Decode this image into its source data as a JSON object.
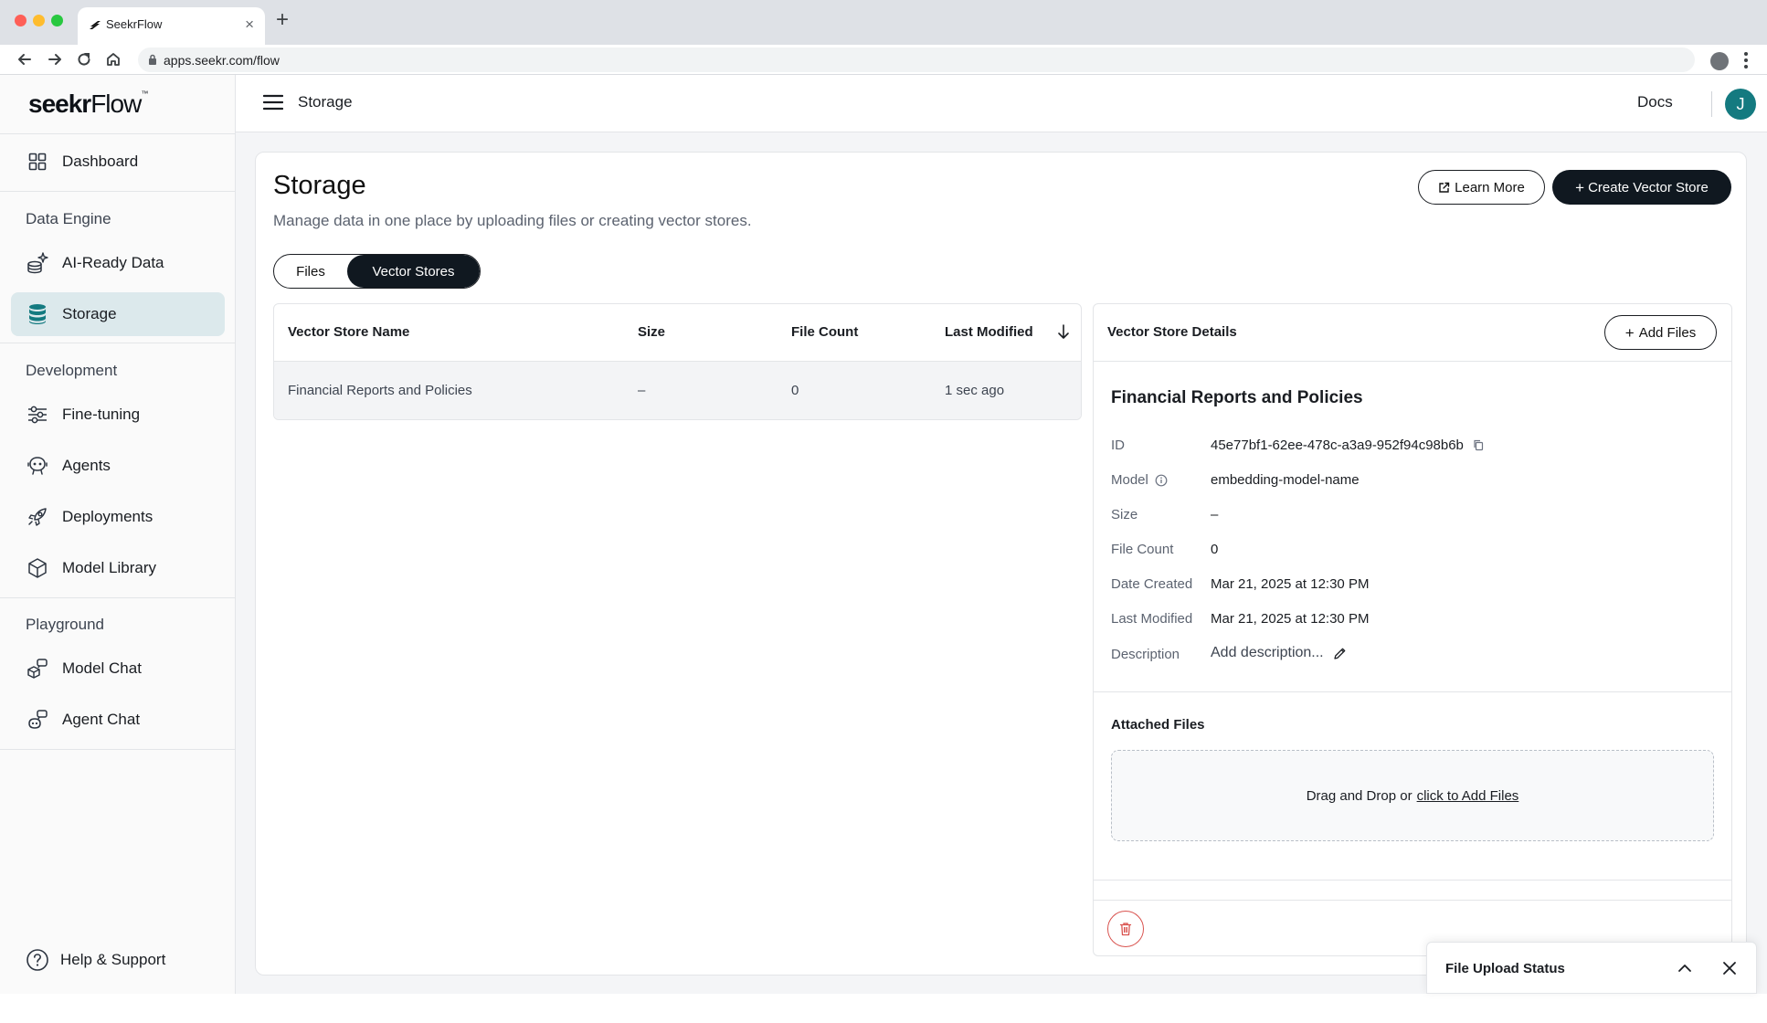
{
  "browser": {
    "tab_title": "SeekrFlow",
    "url": "apps.seekr.com/flow"
  },
  "sidebar": {
    "logo_main": "seekr",
    "logo_flow": "Flow",
    "logo_tm": "™",
    "dashboard": "Dashboard",
    "sections": {
      "data_engine": "Data Engine",
      "development": "Development",
      "playground": "Playground"
    },
    "items": {
      "ai_ready_data": "AI-Ready Data",
      "storage": "Storage",
      "fine_tuning": "Fine-tuning",
      "agents": "Agents",
      "deployments": "Deployments",
      "model_library": "Model Library",
      "model_chat": "Model Chat",
      "agent_chat": "Agent Chat"
    },
    "help": "Help & Support"
  },
  "topbar": {
    "breadcrumb": "Storage",
    "docs": "Docs",
    "avatar_initial": "J"
  },
  "page": {
    "title": "Storage",
    "subtitle": "Manage data in one place by uploading files or creating vector stores.",
    "learn_more": "Learn More",
    "create_vector_store": "Create Vector Store",
    "tabs": [
      "Files",
      "Vector Stores"
    ],
    "active_tab": "Vector Stores"
  },
  "table": {
    "columns": [
      "Vector Store Name",
      "Size",
      "File Count",
      "Last Modified"
    ],
    "sort_column": "Last Modified",
    "sort_direction": "desc",
    "rows": [
      {
        "name": "Financial Reports and Policies",
        "size": "–",
        "file_count": "0",
        "last_modified": "1 sec ago"
      }
    ]
  },
  "details": {
    "header": "Vector Store Details",
    "add_files": "Add Files",
    "name": "Financial Reports and Policies",
    "fields": {
      "id_label": "ID",
      "id_value": "45e77bf1-62ee-478c-a3a9-952f94c98b6b",
      "model_label": "Model",
      "model_value": "embedding-model-name",
      "size_label": "Size",
      "size_value": "–",
      "file_count_label": "File Count",
      "file_count_value": "0",
      "date_created_label": "Date Created",
      "date_created_value": "Mar 21, 2025 at 12:30 PM",
      "last_modified_label": "Last Modified",
      "last_modified_value": "Mar 21, 2025 at 12:30 PM",
      "description_label": "Description",
      "description_placeholder": "Add description..."
    },
    "attached_files_title": "Attached Files",
    "dropzone_text": "Drag and Drop or",
    "dropzone_link": "click to Add Files"
  },
  "toast": {
    "title": "File Upload Status"
  },
  "colors": {
    "accent_teal": "#147a80",
    "active_nav_bg": "#dce9ec",
    "dark_button": "#101820",
    "danger": "#d9534f"
  }
}
